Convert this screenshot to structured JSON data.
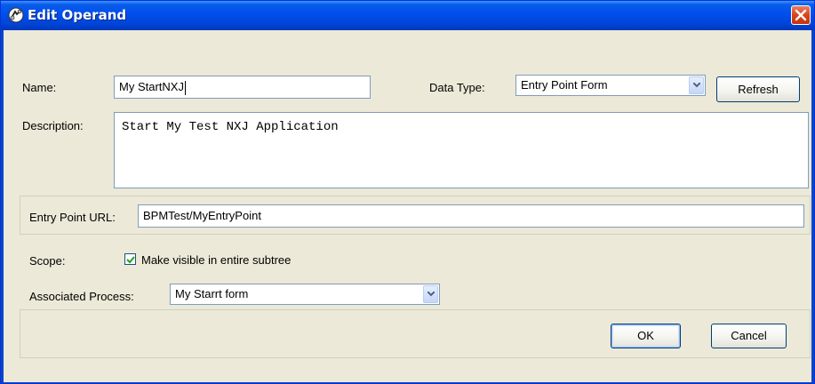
{
  "window": {
    "title": "Edit Operand",
    "icon": "operand-icon"
  },
  "form": {
    "name_label": "Name:",
    "name_value": "My StartNXJ",
    "data_type_label": "Data Type:",
    "data_type_value": "Entry Point Form",
    "refresh_label": "Refresh",
    "description_label": "Description:",
    "description_value": "Start My Test NXJ Application",
    "entry_point_url_label": "Entry Point URL:",
    "entry_point_url_value": "BPMTest/MyEntryPoint",
    "scope_label": "Scope:",
    "scope_checkbox_label": "Make visible in entire subtree",
    "scope_checked": true,
    "associated_process_label": "Associated Process:",
    "associated_process_value": "My Starrt form"
  },
  "buttons": {
    "ok_label": "OK",
    "cancel_label": "Cancel"
  },
  "colors": {
    "titlebar": "#0050ee",
    "close_button": "#d9441c",
    "dialog_background": "#ece9d8",
    "field_border": "#7f9db9",
    "checkmark": "#21a121"
  }
}
